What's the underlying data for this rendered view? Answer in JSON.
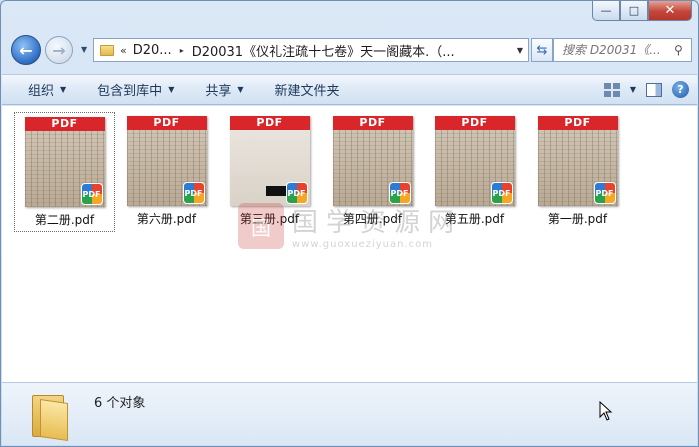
{
  "window": {
    "minimize": "—",
    "maximize": "□",
    "close": "✕"
  },
  "nav": {
    "back_glyph": "←",
    "forward_glyph": "→"
  },
  "address": {
    "chevron": "«",
    "root": "D20...",
    "separator": "▸",
    "current": "D20031《仪礼注疏十七卷》天一阁藏本.（..."
  },
  "search": {
    "placeholder": "搜索 D20031《..."
  },
  "toolbar": {
    "organize": "组织",
    "include_in_library": "包含到库中",
    "share": "共享",
    "new_folder": "新建文件夹"
  },
  "files": [
    {
      "name": "第二册.pdf",
      "thumb_label": "PDF",
      "badge": "PDF",
      "selected": true
    },
    {
      "name": "第六册.pdf",
      "thumb_label": "PDF",
      "badge": "PDF"
    },
    {
      "name": "第三册.pdf",
      "thumb_label": "PDF",
      "badge": "PDF"
    },
    {
      "name": "第四册.pdf",
      "thumb_label": "PDF",
      "badge": "PDF"
    },
    {
      "name": "第五册.pdf",
      "thumb_label": "PDF",
      "badge": "PDF"
    },
    {
      "name": "第一册.pdf",
      "thumb_label": "PDF",
      "badge": "PDF"
    }
  ],
  "watermark": {
    "logo": "国",
    "name": "国学资源网",
    "url": "www.guoxueziyuan.com"
  },
  "details": {
    "item_count": "6 个对象"
  },
  "colors": {
    "pdf_header": "#d8262b",
    "accent": "#2d6cc5"
  }
}
